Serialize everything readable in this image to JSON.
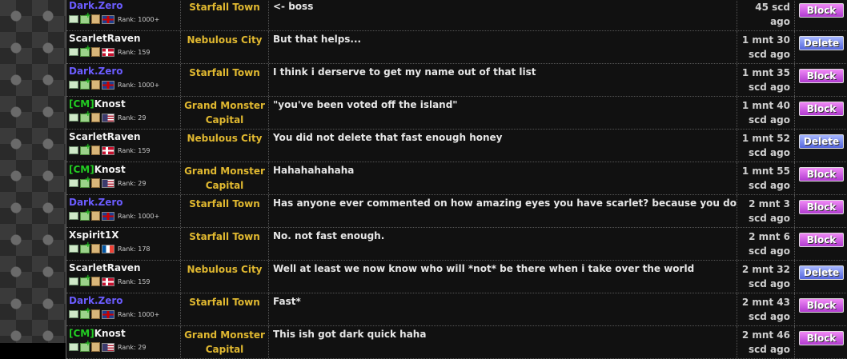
{
  "rows": [
    {
      "user": "Dark.Zero",
      "cm": false,
      "color": "purple",
      "flag": "uk",
      "rank": "Rank: 1000+",
      "town": [
        "Starfall Town"
      ],
      "msg": "<- boss",
      "time": [
        "45 scd ago"
      ],
      "action": "Block"
    },
    {
      "user": "ScarletRaven",
      "cm": false,
      "color": "white",
      "flag": "no",
      "rank": "Rank: 159",
      "town": [
        "Nebulous City"
      ],
      "msg": "But that helps...",
      "time": [
        "1 mnt 30",
        "scd ago"
      ],
      "action": "Delete"
    },
    {
      "user": "Dark.Zero",
      "cm": false,
      "color": "purple",
      "flag": "uk",
      "rank": "Rank: 1000+",
      "town": [
        "Starfall Town"
      ],
      "msg": "I think i derserve to get my name out of that list",
      "time": [
        "1 mnt 35",
        "scd ago"
      ],
      "action": "Block"
    },
    {
      "user": "Knost",
      "cm": true,
      "color": "white",
      "flag": "us",
      "rank": "Rank: 29",
      "town": [
        "Grand Monster",
        "Capital"
      ],
      "msg": "\"you've been voted off the island\"",
      "time": [
        "1 mnt 40",
        "scd ago"
      ],
      "action": "Block"
    },
    {
      "user": "ScarletRaven",
      "cm": false,
      "color": "white",
      "flag": "no",
      "rank": "Rank: 159",
      "town": [
        "Nebulous City"
      ],
      "msg": "You did not delete that fast enough honey",
      "time": [
        "1 mnt 52",
        "scd ago"
      ],
      "action": "Delete"
    },
    {
      "user": "Knost",
      "cm": true,
      "color": "white",
      "flag": "us",
      "rank": "Rank: 29",
      "town": [
        "Grand Monster",
        "Capital"
      ],
      "msg": "Hahahahahaha",
      "time": [
        "1 mnt 55",
        "scd ago"
      ],
      "action": "Block"
    },
    {
      "user": "Dark.Zero",
      "cm": false,
      "color": "purple",
      "flag": "uk",
      "rank": "Rank: 1000+",
      "town": [
        "Starfall Town"
      ],
      "msg": "Has anyone ever commented on how amazing eyes you have scarlet? because you do",
      "time": [
        "2 mnt 3",
        "scd ago"
      ],
      "action": "Block"
    },
    {
      "user": "Xspirit1X",
      "cm": false,
      "color": "white",
      "flag": "fr",
      "rank": "Rank: 178",
      "town": [
        "Starfall Town"
      ],
      "msg": "No. not fast enough.",
      "time": [
        "2 mnt 6",
        "scd ago"
      ],
      "action": "Block"
    },
    {
      "user": "ScarletRaven",
      "cm": false,
      "color": "white",
      "flag": "no",
      "rank": "Rank: 159",
      "town": [
        "Nebulous City"
      ],
      "msg": "Well at least we now know who will *not* be there when i take over the world",
      "time": [
        "2 mnt 32",
        "scd ago"
      ],
      "action": "Delete"
    },
    {
      "user": "Dark.Zero",
      "cm": false,
      "color": "purple",
      "flag": "uk",
      "rank": "Rank: 1000+",
      "town": [
        "Starfall Town"
      ],
      "msg": "Fast*",
      "time": [
        "2 mnt 43",
        "scd ago"
      ],
      "action": "Block"
    },
    {
      "user": "Knost",
      "cm": true,
      "color": "white",
      "flag": "us",
      "rank": "Rank: 29",
      "town": [
        "Grand Monster",
        "Capital"
      ],
      "msg": "This ish got dark quick haha",
      "time": [
        "2 mnt 46",
        "scd ago"
      ],
      "action": "Block"
    }
  ],
  "cm_tag": "[CM]"
}
